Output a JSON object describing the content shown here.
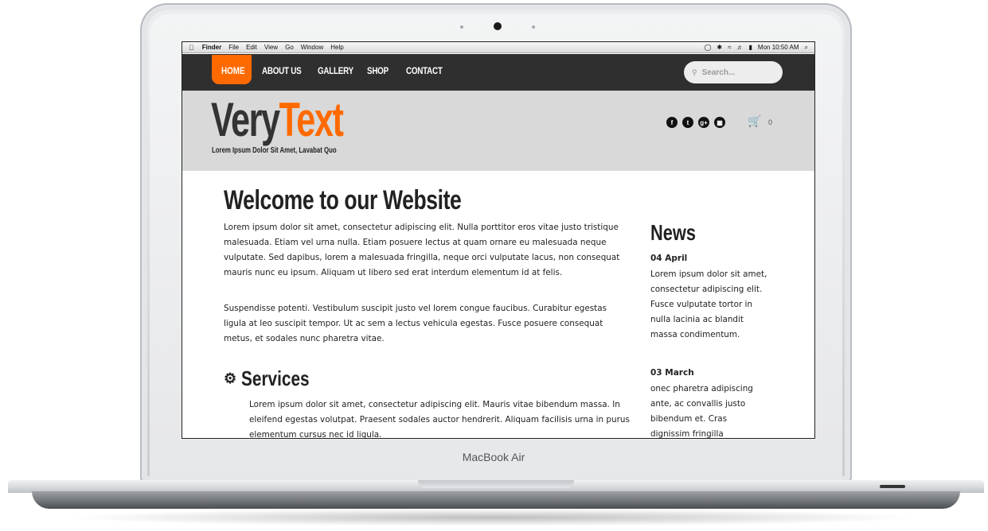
{
  "device": {
    "brand_label": "MacBook Air"
  },
  "menubar": {
    "apple_icon": "apple-icon",
    "items": [
      "Finder",
      "File",
      "Edit",
      "View",
      "Go",
      "Window",
      "Help"
    ],
    "clock": "Mon 10:50 AM"
  },
  "nav": {
    "items": [
      "HOME",
      "ABOUT US",
      "GALLERY",
      "SHOP",
      "CONTACT"
    ],
    "active_color": "#ff6a00",
    "search_placeholder": "Search..."
  },
  "header": {
    "logo_part1": "Very",
    "logo_part2": "Text",
    "tagline": "Lorem Ipsum Dolor Sit Amet, Lavabat Quo",
    "social_icons": [
      "facebook-icon",
      "twitter-icon",
      "google-plus-icon",
      "windows-icon"
    ],
    "cart_count": "0"
  },
  "main": {
    "title": "Welcome to our Website",
    "para1": "Lorem ipsum dolor sit amet, consectetur adipiscing elit. Nulla porttitor eros vitae justo tristique malesuada. Etiam vel urna nulla. Etiam posuere lectus at quam ornare eu malesuada neque vulputate. Sed dapibus, lorem a malesuada fringilla, neque orci vulputate lacus, non consequat mauris nunc eu ipsum. Aliquam ut libero sed erat interdum elementum id at felis.",
    "para2": "Suspendisse potenti. Vestibulum suscipit justo vel lorem congue faucibus. Curabitur egestas ligula at leo suscipit tempor. Ut ac sem a lectus vehicula egestas. Fusce posuere consequat metus, et sodales nunc pharetra vitae.",
    "services_title": "Services",
    "services_text": "Lorem ipsum dolor sit amet, consectetur adipiscing elit. Mauris vitae bibendum massa. In eleifend egestas volutpat. Praesent sodales auctor hendrerit. Aliquam facilisis urna in purus elementum cursus nec id ligula."
  },
  "news": {
    "title": "News",
    "items": [
      {
        "date": "04 April",
        "text": "Lorem ipsum dolor sit amet, consectetur adipiscing elit. Fusce vulputate tortor in nulla lacinia ac blandit massa condimentum."
      },
      {
        "date": "03 March",
        "text": "onec pharetra adipiscing ante, ac convallis justo bibendum et. Cras dignissim fringilla"
      }
    ]
  }
}
